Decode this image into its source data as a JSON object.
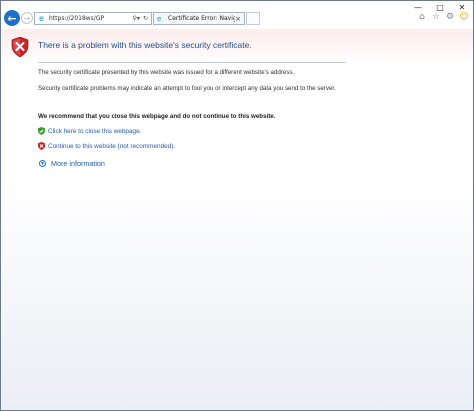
{
  "window": {
    "minimize_icon": "minimize-icon",
    "maximize_icon": "maximize-icon",
    "close_icon": "close-icon"
  },
  "nav": {
    "address": "https://2018ws/GP",
    "search_icon": "search-icon",
    "refresh_icon": "refresh-icon"
  },
  "tab": {
    "title": "Certificate Error: Navigation...",
    "close": "×"
  },
  "toolbar": {
    "icons": [
      "home-icon",
      "favorites-icon",
      "settings-icon",
      "feedback-smiley-icon"
    ]
  },
  "page": {
    "heading": "There is a problem with this website's security certificate.",
    "para1": "The security certificate presented by this website was issued for a different website's address.",
    "para2": "Security certificate problems may indicate an attempt to fool you or intercept any data you send to the server.",
    "recommend": "We recommend that you close this webpage and do not continue to this website.",
    "close_link": "Click here to close this webpage.",
    "continue_link": "Continue to this website (not recommended).",
    "more_info": "More information"
  },
  "colors": {
    "accent": "#1f5fae",
    "heading": "#1f4f93",
    "danger": "#c8242b",
    "safe": "#3b9c2e"
  }
}
